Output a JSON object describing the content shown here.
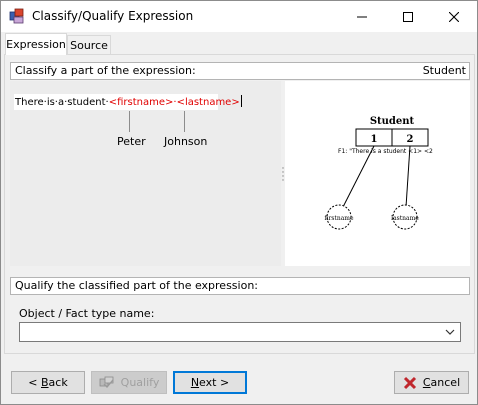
{
  "window": {
    "title": "Classify/Qualify Expression"
  },
  "tabs": [
    {
      "label": "Expression",
      "selected": true
    },
    {
      "label": "Source",
      "selected": false
    }
  ],
  "classify": {
    "header": "Classify a part of the expression:",
    "object_label": "Student",
    "expression": {
      "plain": "There·is·a·student·",
      "role1": "<firstname>",
      "separator": "·",
      "role2": "<lastname>"
    },
    "examples": [
      "Peter",
      "Johnson"
    ]
  },
  "diagram": {
    "object_type": "Student",
    "roles": [
      "1",
      "2"
    ],
    "fact_caption": "F1: \"There is a student <1> <2",
    "role_names": [
      "firstname",
      "lastname"
    ]
  },
  "qualify": {
    "header": "Qualify the classified part of the expression:",
    "field_label": "Object / Fact type name:",
    "field_value": ""
  },
  "buttons": {
    "back": {
      "mnemonic": "B",
      "rest": "ack",
      "prefix": "< "
    },
    "qualify": {
      "label": "Qualify",
      "enabled": false
    },
    "next": {
      "mnemonic": "N",
      "rest": "ext >"
    },
    "cancel": {
      "mnemonic": "C",
      "rest": "ancel"
    }
  },
  "colors": {
    "accent": "#0078d7",
    "role_text": "#e00000",
    "cancel_icon": "#c0272d"
  },
  "icons": [
    "app-icon",
    "minimize-icon",
    "maximize-icon",
    "close-icon",
    "chevron-down-icon",
    "qualify-icon",
    "cancel-x-icon"
  ]
}
